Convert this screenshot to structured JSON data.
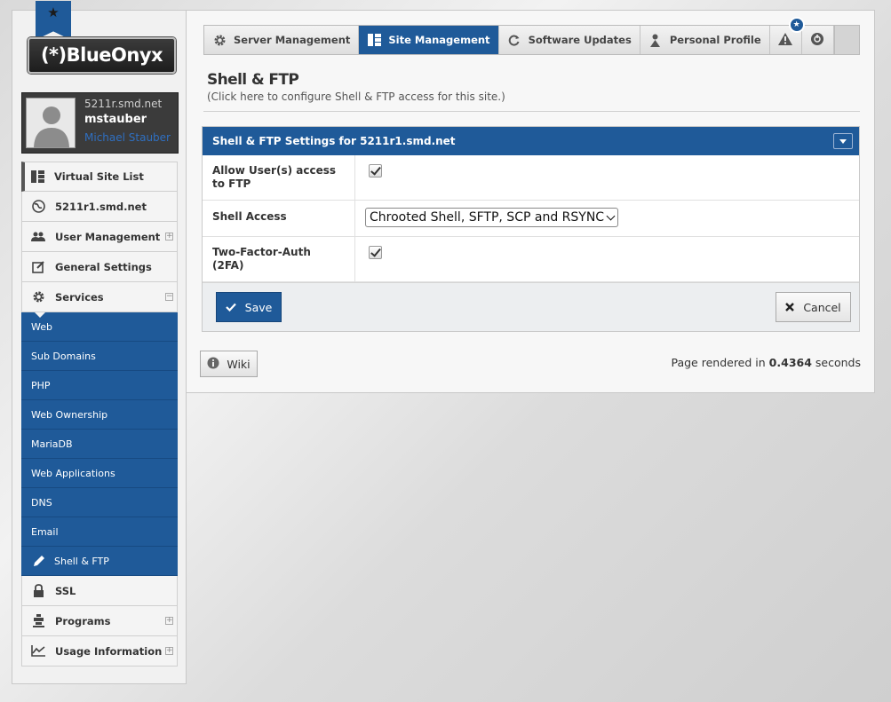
{
  "logo": {
    "text": "(*)BlueOnyx"
  },
  "user": {
    "host": "5211r.smd.net",
    "username": "mstauber",
    "fullname": "Michael Stauber"
  },
  "sidebar": {
    "items": [
      {
        "label": "Virtual Site List",
        "icon": "site-list-icon"
      },
      {
        "label": "5211r1.smd.net",
        "icon": "globe-icon"
      },
      {
        "label": "User Management",
        "icon": "users-icon",
        "expander": "+"
      },
      {
        "label": "General Settings",
        "icon": "edit-icon"
      },
      {
        "label": "Services",
        "icon": "gear-icon",
        "expander": "−"
      }
    ],
    "services_sub": [
      {
        "label": "Web"
      },
      {
        "label": "Sub Domains"
      },
      {
        "label": "PHP"
      },
      {
        "label": "Web Ownership"
      },
      {
        "label": "MariaDB"
      },
      {
        "label": "Web Applications"
      },
      {
        "label": "DNS"
      },
      {
        "label": "Email"
      },
      {
        "label": "Shell & FTP",
        "icon": "pencil-icon"
      }
    ],
    "items_after": [
      {
        "label": "SSL",
        "icon": "lock-icon"
      },
      {
        "label": "Programs",
        "icon": "programs-icon",
        "expander": "+"
      },
      {
        "label": "Usage Information",
        "icon": "chart-icon",
        "expander": "+"
      }
    ]
  },
  "tabs": [
    {
      "label": "Server Management",
      "icon": "gear-icon"
    },
    {
      "label": "Site Management",
      "icon": "site-list-icon",
      "active": true
    },
    {
      "label": "Software Updates",
      "icon": "refresh-icon"
    },
    {
      "label": "Personal Profile",
      "icon": "person-icon"
    }
  ],
  "page": {
    "title": "Shell & FTP",
    "subtitle": "(Click here to configure Shell & FTP access for this site.)"
  },
  "panel": {
    "title": "Shell & FTP Settings for 5211r1.smd.net",
    "rows": [
      {
        "label": "Allow User(s) access to FTP",
        "type": "checkbox",
        "checked": true
      },
      {
        "label": "Shell Access",
        "type": "select",
        "value": "Chrooted Shell, SFTP, SCP and RSYNC"
      },
      {
        "label": "Two-Factor-Auth (2FA)",
        "type": "checkbox",
        "checked": true
      }
    ],
    "save_label": "Save",
    "cancel_label": "Cancel"
  },
  "footer": {
    "wiki_label": "Wiki",
    "rendered_prefix": "Page rendered in",
    "rendered_time": "0.4364",
    "rendered_suffix": "seconds"
  },
  "colors": {
    "brand_blue": "#1f5a99",
    "sidebar_bg": "#f4f4f4",
    "user_box": "#3b3b3b"
  }
}
